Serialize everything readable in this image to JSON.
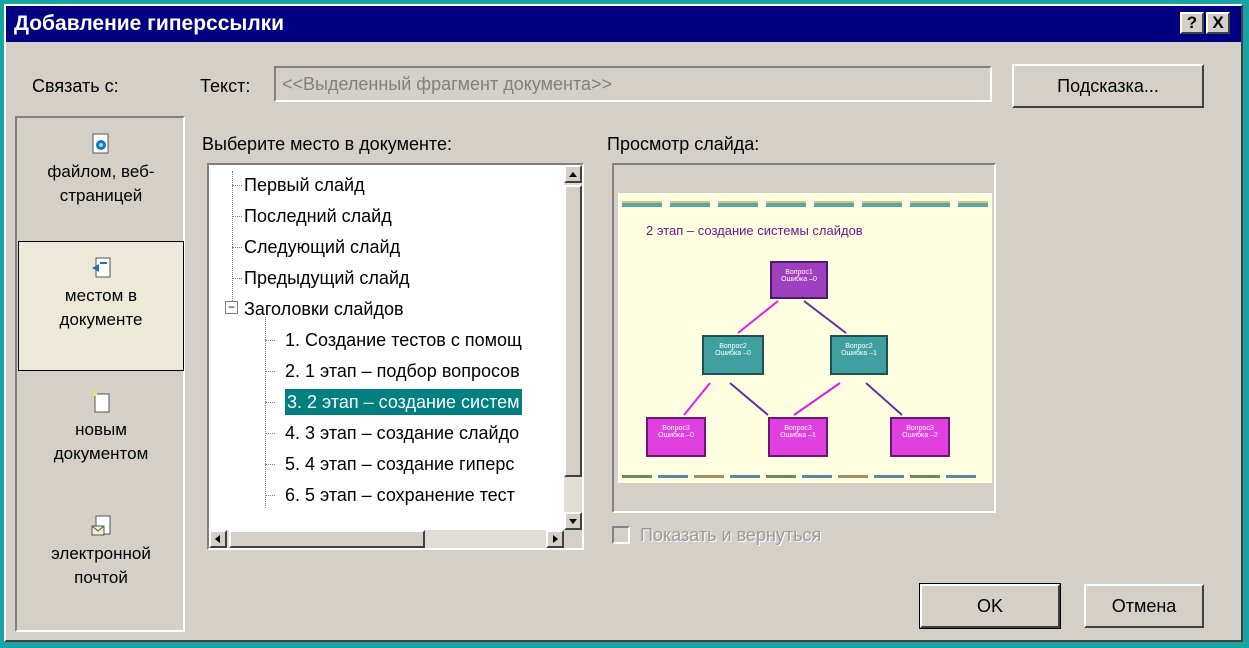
{
  "dialog": {
    "title": "Добавление гиперссылки",
    "help_button": "?",
    "close_button": "X"
  },
  "link_with": {
    "label": "Связать с:",
    "items": [
      {
        "label": "файлом, веб-\nстраницей",
        "icon": "file-web-icon"
      },
      {
        "label": "местом в\nдокументе",
        "icon": "document-place-icon"
      },
      {
        "label": "новым\nдокументом",
        "icon": "new-document-icon"
      },
      {
        "label": "электронной\nпочтой",
        "icon": "email-icon"
      }
    ]
  },
  "text_field": {
    "label": "Текст:",
    "value": "<<Выделенный фрагмент документа>>"
  },
  "hint_button": "Подсказка...",
  "place": {
    "label": "Выберите место в документе:",
    "items": [
      "Первый слайд",
      "Последний слайд",
      "Следующий слайд",
      "Предыдущий слайд",
      "Заголовки слайдов",
      "1. Создание тестов с помощ",
      "2. 1 этап – подбор вопросов",
      "3. 2 этап – создание систем",
      "4. 3 этап – создание слайдо",
      "5. 4 этап – создание гиперс",
      "6. 5 этап – сохранение тест"
    ],
    "expander": "−"
  },
  "preview": {
    "label": "Просмотр слайда:",
    "slide_title": "2 этап – создание системы слайдов",
    "nodes": [
      {
        "line1": "Вопрос1",
        "line2": "Ошибка –0"
      },
      {
        "line1": "Вопрос2",
        "line2": "Ошибка –0"
      },
      {
        "line1": "Вопрос2",
        "line2": "Ошибка –1"
      },
      {
        "line1": "Вопрос3",
        "line2": "Ошибка –0"
      },
      {
        "line1": "Вопрос3",
        "line2": "Ошибка –1"
      },
      {
        "line1": "Вопрос3",
        "line2": "Ошибка –2"
      }
    ]
  },
  "show_and_return": {
    "label": "Показать и вернуться",
    "checked": false,
    "enabled": false
  },
  "ok_button": "OK",
  "cancel_button": "Отмена",
  "colors": {
    "titlebar": "#000080",
    "selection": "#008080",
    "desktop": "#17a4a4"
  }
}
